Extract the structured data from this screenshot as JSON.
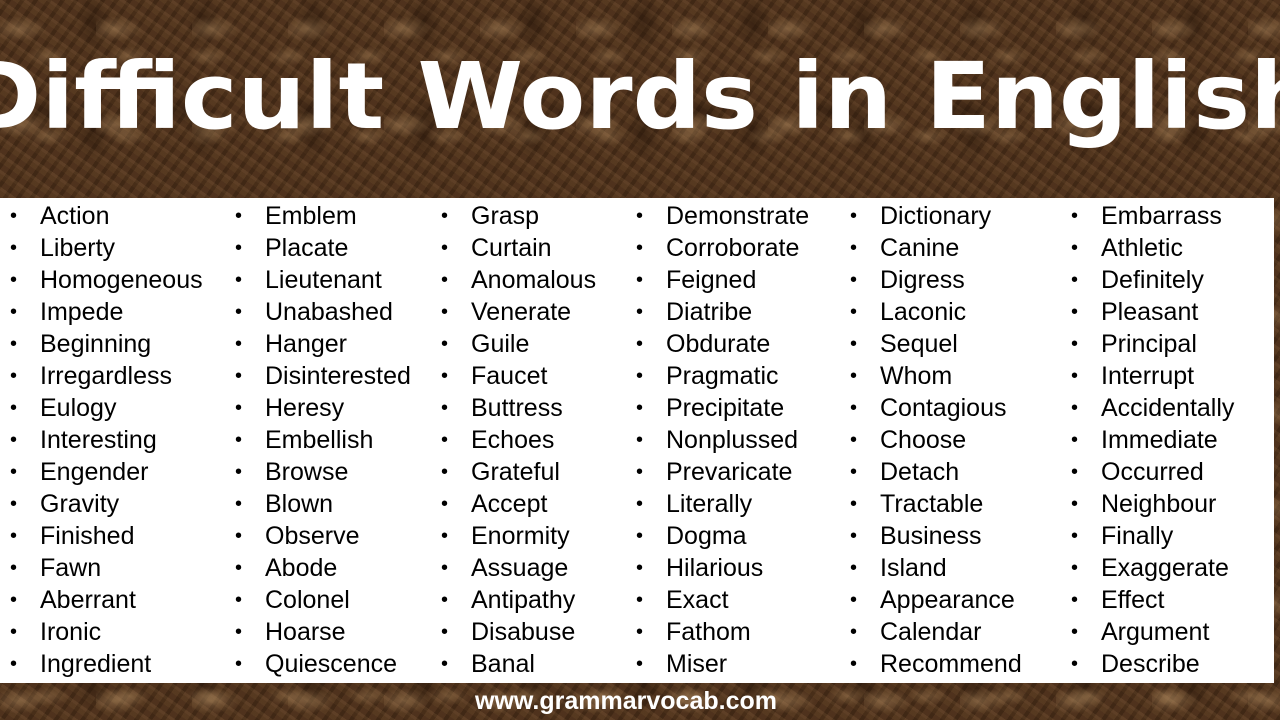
{
  "header": {
    "title": "Difficult Words in English"
  },
  "bullet_glyph": "•",
  "columns": [
    [
      "Action",
      "Liberty",
      "Homogeneous",
      "Impede",
      "Beginning",
      "Irregardless",
      "Eulogy",
      "Interesting",
      "Engender",
      "Gravity",
      "Finished",
      "Fawn",
      "Aberrant",
      "Ironic",
      "Ingredient"
    ],
    [
      "Emblem",
      "Placate",
      "Lieutenant",
      "Unabashed",
      "Hanger",
      "Disinterested",
      "Heresy",
      "Embellish",
      "Browse",
      "Blown",
      "Observe",
      "Abode",
      "Colonel",
      "Hoarse",
      "Quiescence"
    ],
    [
      "Grasp",
      "Curtain",
      "Anomalous",
      "Venerate",
      "Guile",
      "Faucet",
      "Buttress",
      "Echoes",
      "Grateful",
      "Accept",
      "Enormity",
      "Assuage",
      "Antipathy",
      "Disabuse",
      "Banal"
    ],
    [
      "Demonstrate",
      "Corroborate",
      "Feigned",
      "Diatribe",
      "Obdurate",
      "Pragmatic",
      "Precipitate",
      "Nonplussed",
      "Prevaricate",
      "Literally",
      "Dogma",
      "Hilarious",
      "Exact",
      "Fathom",
      "Miser"
    ],
    [
      "Dictionary",
      "Canine",
      "Digress",
      "Laconic",
      "Sequel",
      "Whom",
      "Contagious",
      "Choose",
      "Detach",
      "Tractable",
      "Business",
      "Island",
      "Appearance",
      "Calendar",
      "Recommend"
    ],
    [
      "Embarrass",
      "Athletic",
      "Definitely",
      "Pleasant",
      "Principal",
      "Interrupt",
      "Accidentally",
      "Immediate",
      "Occurred",
      "Neighbour",
      "Finally",
      "Exaggerate",
      "Effect",
      "Argument",
      "Describe"
    ]
  ],
  "footer": {
    "website": "www.grammarvocab.com"
  },
  "colors": {
    "background_texture": "#4a2f1a",
    "panel": "#ffffff",
    "text": "#000000",
    "title": "#ffffff"
  }
}
